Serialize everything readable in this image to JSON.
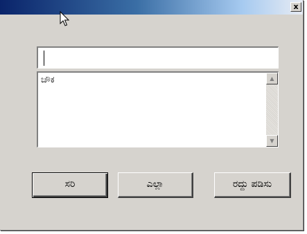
{
  "window": {
    "title": "",
    "close_label": "x"
  },
  "input": {
    "value": ""
  },
  "list": {
    "items": [
      "ಚೌಕ"
    ]
  },
  "scrollbar": {
    "up_icon": "▲",
    "down_icon": "▼"
  },
  "buttons": {
    "ok_label": "ಸರಿ",
    "all_label": "ಎಲ್ಲಾ",
    "cancel_label": "ರದ್ದು ಪಡಿಸು"
  },
  "colors": {
    "title_start": "#0a246a",
    "title_end": "#e8ecf4",
    "face": "#d6d3ce"
  }
}
